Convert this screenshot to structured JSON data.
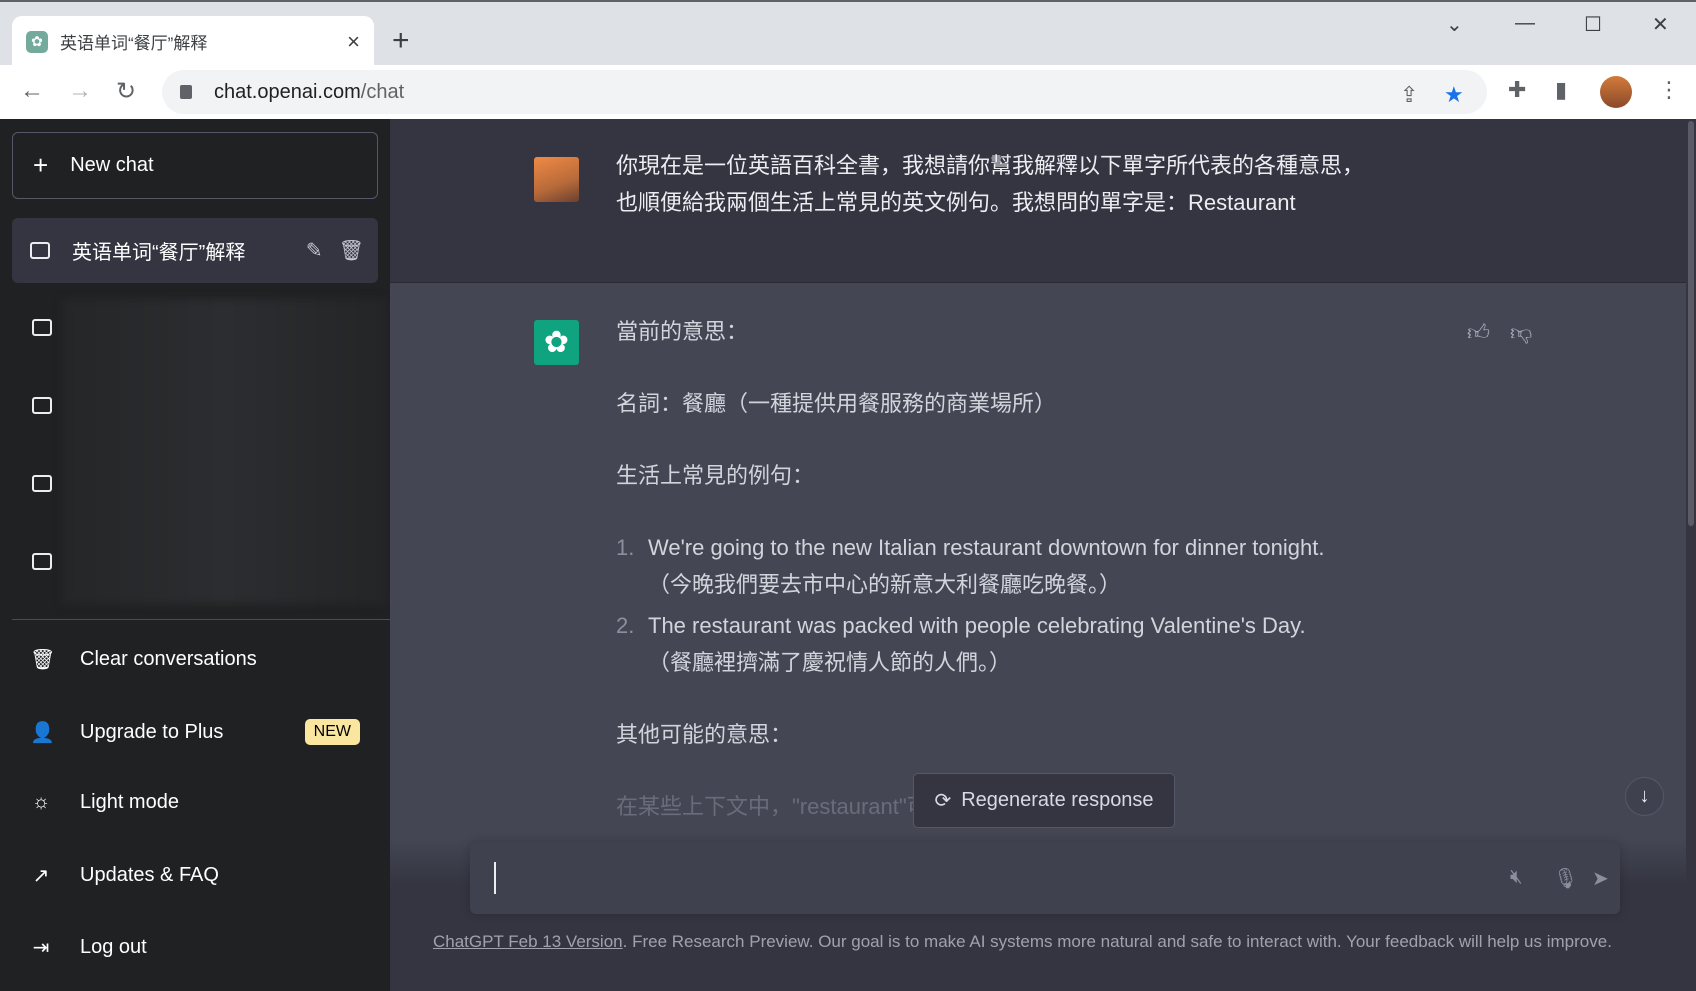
{
  "browser": {
    "tab_title": "英语单词“餐厅”解释",
    "tab_close": "×",
    "new_tab": "+",
    "url_host": "chat.openai.com",
    "url_path": "/chat",
    "win_controls": [
      "⌄",
      "—",
      "☐",
      "✕"
    ]
  },
  "sidebar": {
    "new_chat": "New chat",
    "active_conversation": "英语单词“餐厅”解释",
    "items": [
      {
        "label": "Clear conversations",
        "icon": "trash-icon"
      },
      {
        "label": "Upgrade to Plus",
        "icon": "user-icon",
        "badge": "NEW"
      },
      {
        "label": "Light mode",
        "icon": "sun-icon"
      },
      {
        "label": "Updates & FAQ",
        "icon": "external-link-icon"
      },
      {
        "label": "Log out",
        "icon": "logout-icon"
      }
    ]
  },
  "chat": {
    "user_message": [
      "你現在是一位英語百科全書，我想請你幫我解釋以下單字所代表的各種意思，",
      "也順便給我兩個生活上常見的英文例句。我想問的單字是：Restaurant"
    ],
    "assistant": {
      "heading": "當前的意思：",
      "noun": "名詞：餐廳（一種提供用餐服務的商業場所）",
      "examples_heading": "生活上常見的例句：",
      "examples": [
        {
          "num": "1.",
          "en": "We're going to the new Italian restaurant downtown for dinner tonight.",
          "zh": "（今晚我們要去市中心的新意大利餐廳吃晚餐。）"
        },
        {
          "num": "2.",
          "en": "The restaurant was packed with people celebrating Valentine's Day.",
          "zh": "（餐廳裡擠滿了慶祝情人節的人們。）"
        }
      ],
      "other_heading": "其他可能的意思：",
      "faded_line": "在某些上下文中，\"restaurant\"可以指："
    },
    "regenerate": "Regenerate response",
    "input_value": "",
    "footer_link": "ChatGPT Feb 13 Version",
    "footer_text": ". Free Research Preview. Our goal is to make AI systems more natural and safe to interact with. Your feedback will help us improve."
  }
}
